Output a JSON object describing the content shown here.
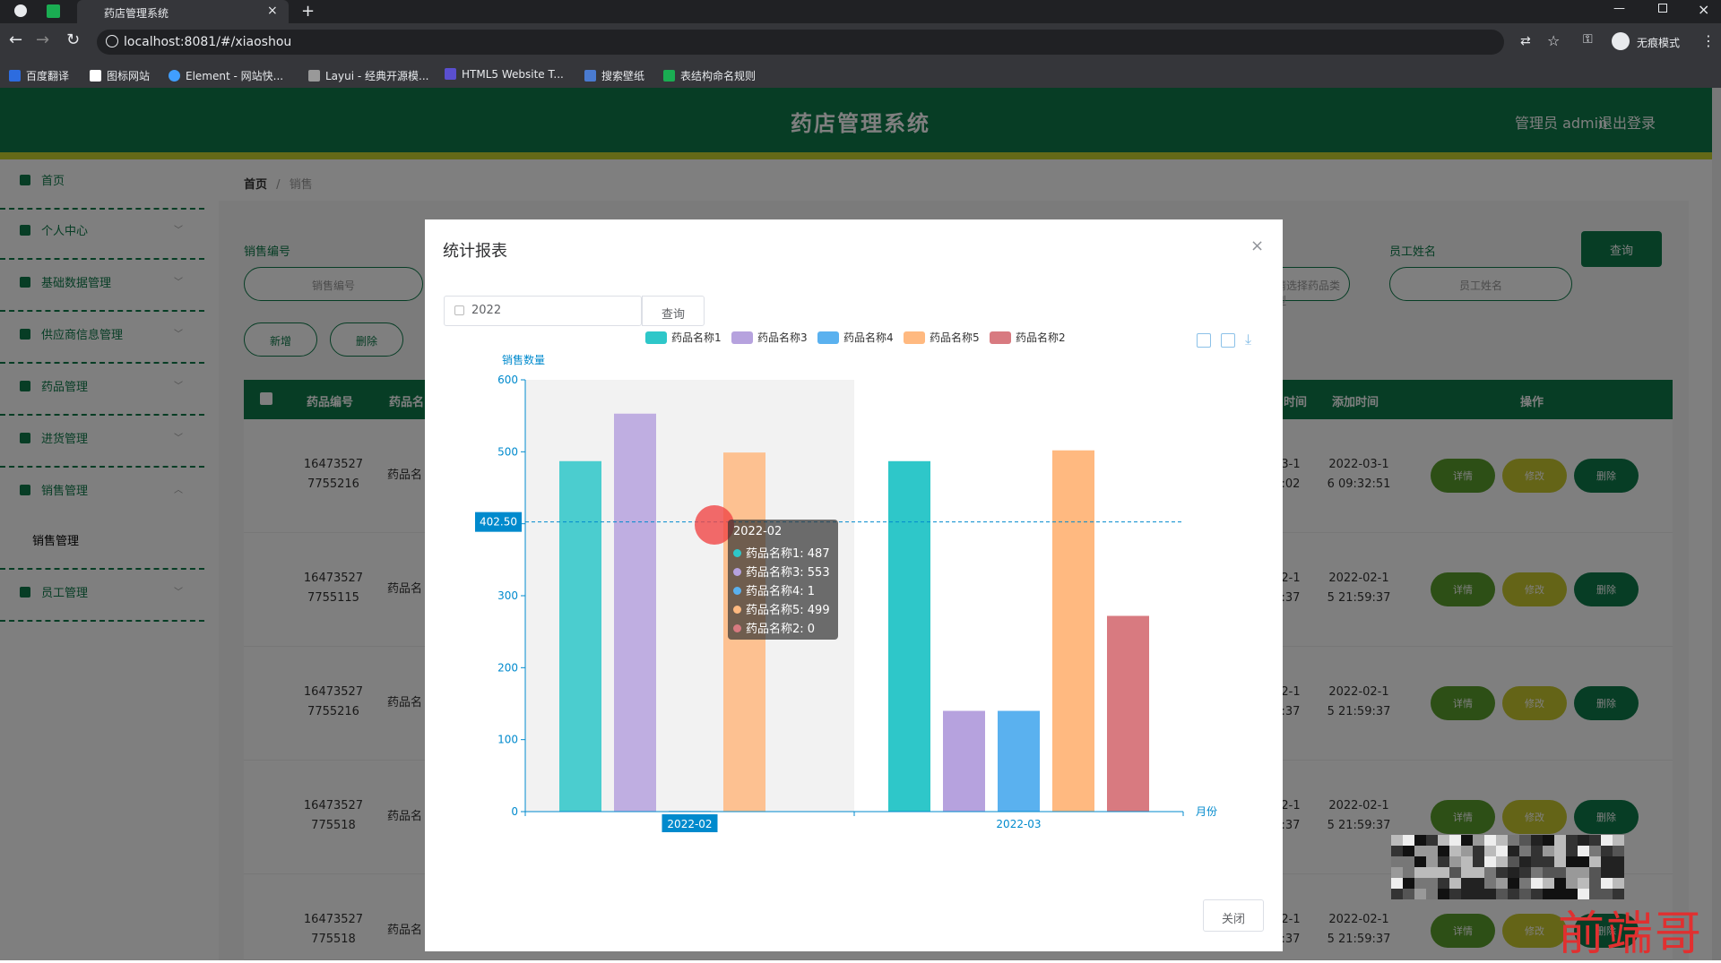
{
  "browser": {
    "tab_title": "药店管理系统",
    "url": "localhost:8081/#/xiaoshou",
    "profile_label": "无痕模式",
    "bookmarks": [
      "百度翻译",
      "图标网站",
      "Element - 网站快...",
      "Layui - 经典开源模...",
      "HTML5 Website T...",
      "搜索壁纸",
      "表结构命名规则"
    ]
  },
  "header": {
    "title": "药店管理系统",
    "admin_label": "管理员 admin",
    "logout_label": "退出登录"
  },
  "sidebar": {
    "items": [
      {
        "label": "首页"
      },
      {
        "label": "个人中心"
      },
      {
        "label": "基础数据管理"
      },
      {
        "label": "供应商信息管理"
      },
      {
        "label": "药品管理"
      },
      {
        "label": "进货管理"
      },
      {
        "label": "销售管理"
      },
      {
        "label": "销售管理"
      },
      {
        "label": "员工管理"
      }
    ]
  },
  "breadcrumb": {
    "home": "首页",
    "sep": "/",
    "current": "销售"
  },
  "search": {
    "label_sale_no": "销售编号",
    "label_employee": "员工姓名",
    "placeholder_sale_no": "销售编号",
    "placeholder_type": "请选择药品类型",
    "placeholder_employee": "员工姓名",
    "query_label": "查询"
  },
  "actions": {
    "add_label": "新增",
    "delete_label": "删除"
  },
  "table": {
    "headers": [
      "药品编号",
      "药品名",
      "时间",
      "添加时间",
      "操作"
    ],
    "rows": [
      {
        "code": "16473527 7755216",
        "name": "药品名",
        "date_frag": "3-1 :02",
        "added": "2022-03-1 6 09:32:51"
      },
      {
        "code": "16473527 7755115",
        "name": "药品名",
        "date_frag": "2-1 :37",
        "added": "2022-02-1 5 21:59:37"
      },
      {
        "code": "16473527 7755216",
        "name": "药品名",
        "date_frag": "2-1 :37",
        "added": "2022-02-1 5 21:59:37"
      },
      {
        "code": "16473527 775518",
        "name": "药品名",
        "date_frag": "2-1 :37",
        "added": "2022-02-1 5 21:59:37"
      },
      {
        "code": "16473527 775518",
        "name": "药品名",
        "date_frag": "2-1 :37",
        "added": "2022-02-1 5 21:59:37"
      }
    ],
    "btn_detail": "详情",
    "btn_edit": "修改",
    "btn_delete": "删除"
  },
  "modal": {
    "title": "统计报表",
    "year_value": "2022",
    "query_label": "查询",
    "close_label": "关闭"
  },
  "chart_data": {
    "type": "bar",
    "categories": [
      "2022-02",
      "2022-03"
    ],
    "series": [
      {
        "name": "药品名称1",
        "values": [
          487,
          487
        ],
        "color": "#2ec7c9"
      },
      {
        "name": "药品名称3",
        "values": [
          553,
          140
        ],
        "color": "#b6a2de"
      },
      {
        "name": "药品名称4",
        "values": [
          1,
          140
        ],
        "color": "#5ab1ef"
      },
      {
        "name": "药品名称5",
        "values": [
          499,
          502
        ],
        "color": "#ffb980"
      },
      {
        "name": "药品名称2",
        "values": [
          0,
          272
        ],
        "color": "#d87a80"
      }
    ],
    "ylabel": "销售数量",
    "xlabel": "月份",
    "ylim": [
      0,
      600
    ],
    "yticks": [
      0,
      100,
      200,
      300,
      400,
      500,
      600
    ],
    "legend_position": "top-center",
    "grid": false,
    "axis_pointer_value": "402.50",
    "highlighted_category": "2022-02",
    "tooltip": {
      "title": "2022-02",
      "lines": [
        "药品名称1: 487",
        "药品名称3: 553",
        "药品名称4: 1",
        "药品名称5: 499",
        "药品名称2: 0"
      ]
    }
  },
  "watermark": "前端哥",
  "colors": {
    "primary": "#0e7a4a",
    "accent_bar": "#c9d22e",
    "axis": "#008acd"
  }
}
